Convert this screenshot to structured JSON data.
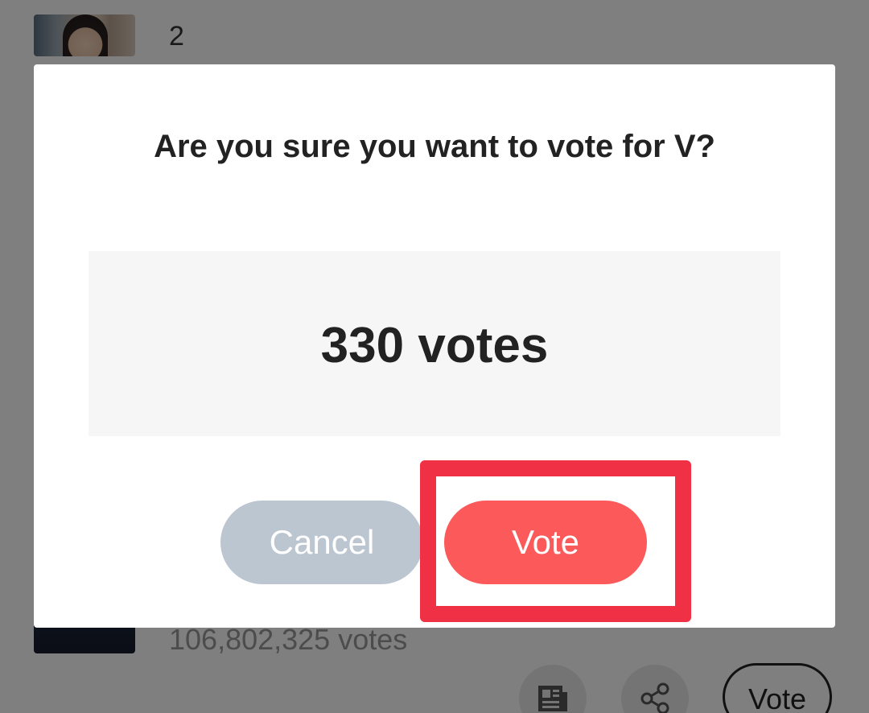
{
  "background": {
    "rank_row": {
      "number": "2"
    },
    "entry": {
      "votes_text": "106,802,325 votes",
      "news_icon": "newspaper-icon",
      "share_icon": "share-icon",
      "vote_label": "Vote"
    }
  },
  "dialog": {
    "title": "Are you sure you want to vote for V?",
    "votes_amount": "330 votes",
    "cancel_label": "Cancel",
    "vote_label": "Vote"
  },
  "highlight": {
    "target": "vote-button",
    "color": "#ef3045"
  },
  "colors": {
    "vote_button": "#fc5a5a",
    "cancel_button": "#bcc6d0",
    "overlay": "rgba(0,0,0,0.5)"
  }
}
